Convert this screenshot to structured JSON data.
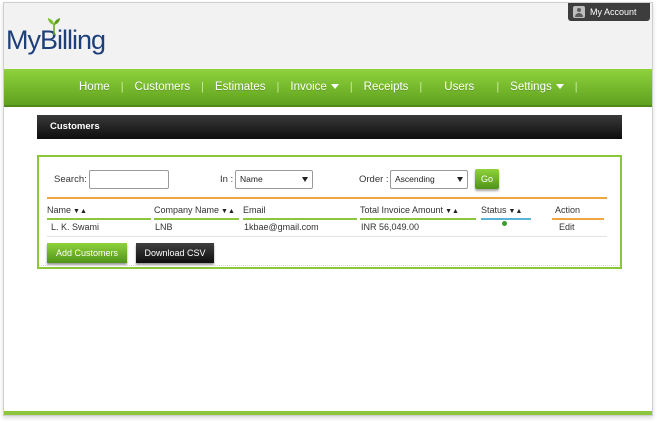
{
  "brand": {
    "logo_text": "MyBilling"
  },
  "header": {
    "account_label": "My Account"
  },
  "nav": {
    "items": [
      {
        "label": "Home"
      },
      {
        "label": "Customers"
      },
      {
        "label": "Estimates"
      },
      {
        "label": "Invoice"
      },
      {
        "label": "Receipts"
      },
      {
        "label": "Users"
      },
      {
        "label": "Settings"
      }
    ],
    "separator": "|"
  },
  "page": {
    "title": "Customers"
  },
  "filters": {
    "search_label": "Search:",
    "search_value": "",
    "in_label": "In :",
    "in_selected": "Name",
    "order_label": "Order :",
    "order_selected": "Ascending",
    "go_label": "Go"
  },
  "table": {
    "columns": [
      {
        "label": "Name",
        "sortable": true
      },
      {
        "label": "Company Name",
        "sortable": true
      },
      {
        "label": "Email",
        "sortable": false
      },
      {
        "label": "Total Invoice Amount",
        "sortable": true
      },
      {
        "label": "Status",
        "sortable": true
      },
      {
        "label": "Action",
        "sortable": false
      }
    ],
    "sort_glyph": "▼▲",
    "rows": [
      {
        "name": "L. K. Swami",
        "company": "LNB",
        "email": "1kbae@gmail.com",
        "total": "INR 56,049.00",
        "status": "active",
        "action": "Edit"
      }
    ]
  },
  "actions": {
    "add_label": "Add Customers",
    "csv_label": "Download CSV"
  },
  "colors": {
    "accent_green": "#8cc63f",
    "nav_dark_green": "#5fa11f",
    "title_bar_black": "#0d0d0d",
    "table_orange": "#f0a640",
    "logo_blue": "#1d3f7a",
    "status_active": "#3b9b2d"
  }
}
